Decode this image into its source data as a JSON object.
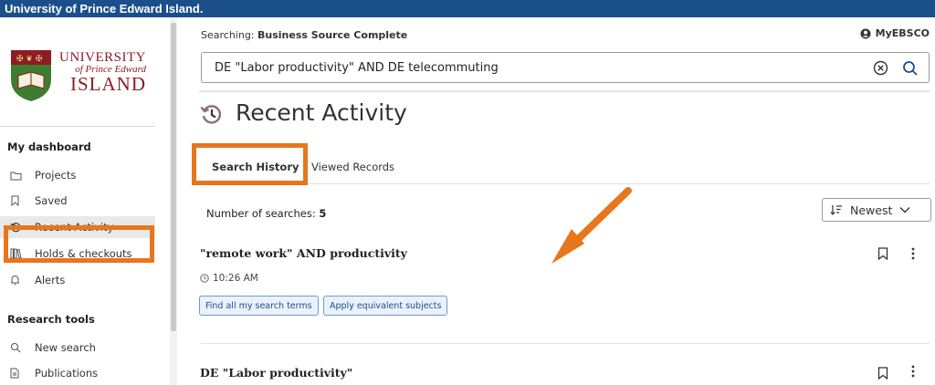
{
  "topbar": {
    "title": "University of Prince Edward Island."
  },
  "logo": {
    "line1": "UNIVERSITY",
    "line2": "of Prince Edward",
    "line3": "ISLAND"
  },
  "sidebar": {
    "dashboard_title": "My dashboard",
    "dashboard_items": [
      {
        "label": "Projects",
        "icon": "folder-icon"
      },
      {
        "label": "Saved",
        "icon": "bookmark-icon"
      },
      {
        "label": "Recent Activity",
        "icon": "history-icon",
        "active": true
      },
      {
        "label": "Holds & checkouts",
        "icon": "books-icon"
      },
      {
        "label": "Alerts",
        "icon": "bell-icon"
      }
    ],
    "research_title": "Research tools",
    "research_items": [
      {
        "label": "New search",
        "icon": "search-icon"
      },
      {
        "label": "Publications",
        "icon": "document-icon"
      }
    ]
  },
  "header": {
    "searching_prefix": "Searching:",
    "database": "Business Source Complete",
    "account_label": "MyEBSCO"
  },
  "search": {
    "value": "DE \"Labor productivity\" AND DE telecommuting"
  },
  "page": {
    "title": "Recent Activity"
  },
  "tabs": [
    {
      "label": "Search History",
      "selected": true
    },
    {
      "label": "Viewed Records",
      "selected": false
    }
  ],
  "summary": {
    "count_label": "Number of searches:",
    "count": "5"
  },
  "sort": {
    "selected": "Newest"
  },
  "results": [
    {
      "title": "\"remote work\" AND productivity",
      "time": "10:26 AM",
      "actions": [
        "Find all my search terms",
        "Apply equivalent subjects"
      ]
    },
    {
      "title": "DE \"Labor productivity\""
    }
  ],
  "colors": {
    "brand": "#1b4f8a",
    "highlight": "#e8761c",
    "logo_red": "#8c1d24"
  }
}
